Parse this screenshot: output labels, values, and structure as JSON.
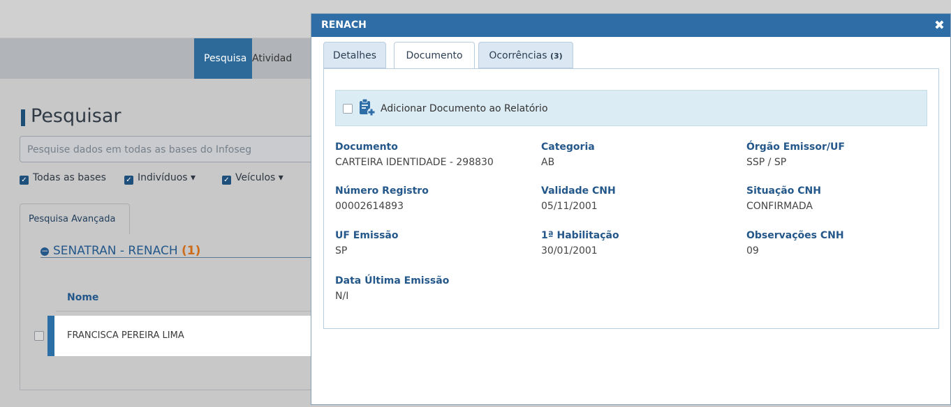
{
  "background": {
    "nav_tabs": [
      "Pesquisa",
      "Atividad"
    ],
    "title": "Pesquisar",
    "search": {
      "placeholder": "Pesquise dados em todas as bases do Infoseg"
    },
    "filters": [
      "Todas as bases",
      "Indivíduos",
      "Veículos"
    ],
    "advanced_tab": "Pesquisa Avançada",
    "section": {
      "label": "SENATRAN - RENACH",
      "count": "(1)"
    },
    "column_header": "Nome",
    "row_name": "FRANCISCA PEREIRA LIMA"
  },
  "modal": {
    "title": "RENACH",
    "close_icon": "close-icon",
    "tabs": [
      {
        "label": "Detalhes",
        "active": false
      },
      {
        "label": "Documento",
        "active": true
      },
      {
        "label": "Ocorrências",
        "badge": "(3)",
        "active": false
      }
    ],
    "add_to_report_label": "Adicionar Documento ao Relatório",
    "fields": [
      {
        "label": "Documento",
        "value": "CARTEIRA IDENTIDADE - 298830"
      },
      {
        "label": "Categoria",
        "value": "AB"
      },
      {
        "label": "Órgão Emissor/UF",
        "value": "SSP / SP"
      },
      {
        "label": "Número Registro",
        "value": "00002614893"
      },
      {
        "label": "Validade CNH",
        "value": "05/11/2001"
      },
      {
        "label": "Situação CNH",
        "value": "CONFIRMADA"
      },
      {
        "label": "UF Emissão",
        "value": "SP"
      },
      {
        "label": "1ª Habilitação",
        "value": "30/01/2001"
      },
      {
        "label": "Observações CNH",
        "value": "09"
      },
      {
        "label": "Data Última Emissão",
        "value": "N/I"
      }
    ]
  },
  "colors": {
    "primary": "#2e6da6",
    "label_blue": "#24578a",
    "accent_orange": "#cc6b19"
  }
}
